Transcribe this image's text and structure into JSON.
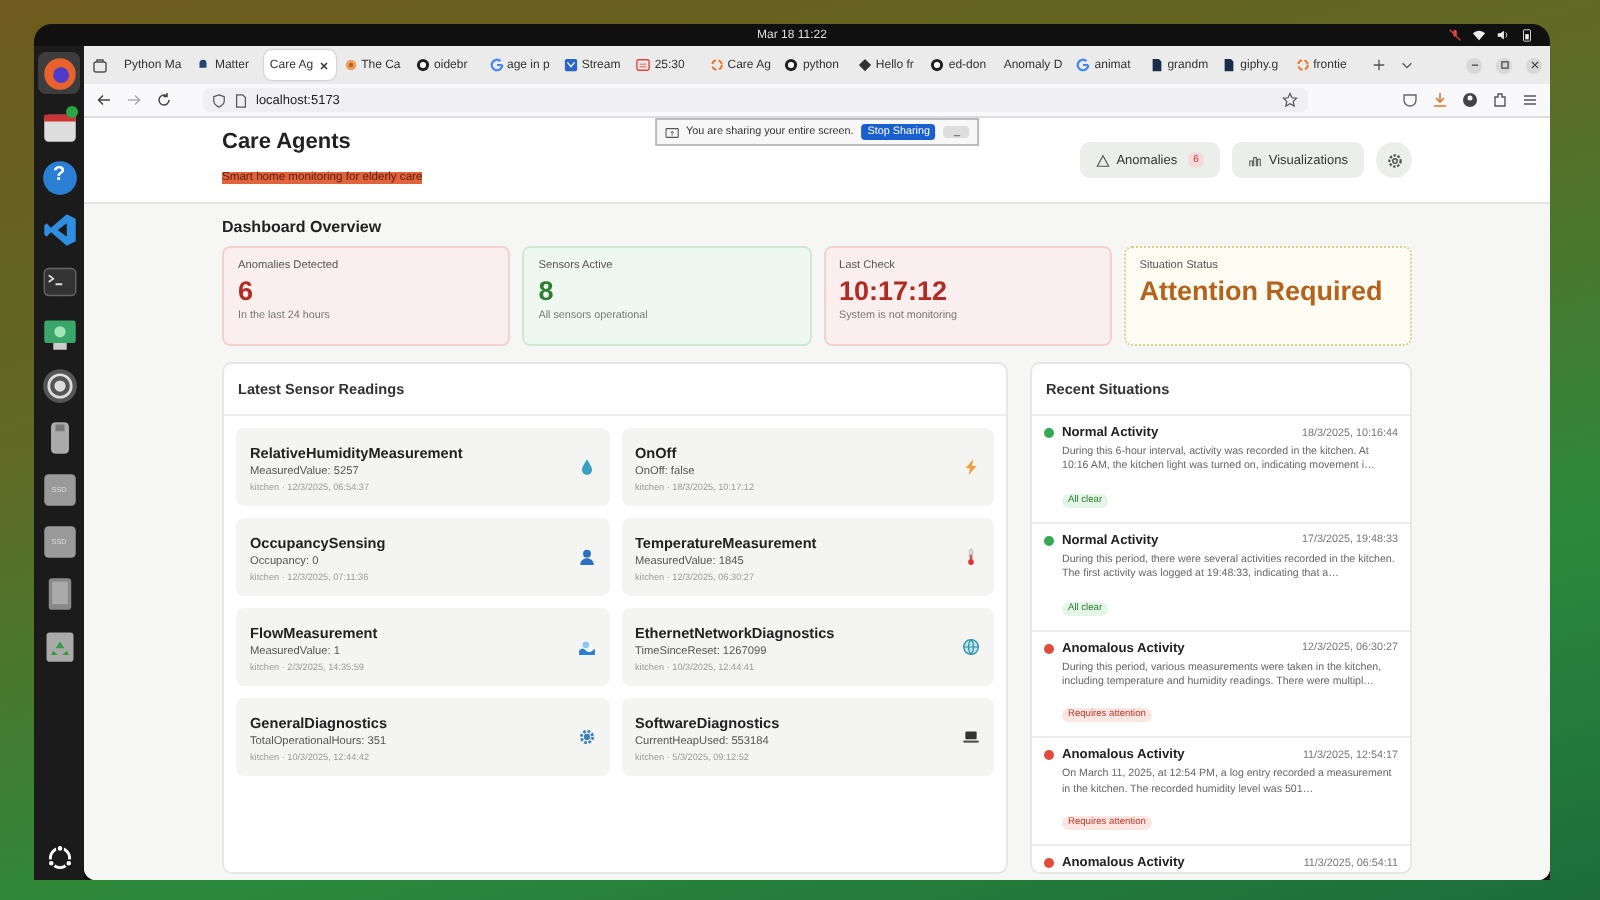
{
  "top_bar": {
    "clock": "Mar 18  11:22"
  },
  "dock": {
    "items": [
      {
        "kind": "browser",
        "active": true,
        "badge": false
      },
      {
        "kind": "calendar",
        "active": false,
        "badge": true
      },
      {
        "kind": "help",
        "active": false,
        "badge": false,
        "glyph": "?"
      },
      {
        "kind": "code",
        "active": false,
        "badge": false
      },
      {
        "kind": "terminal",
        "active": false,
        "badge": false
      },
      {
        "kind": "android",
        "active": false,
        "badge": false
      },
      {
        "kind": "settings",
        "active": false,
        "badge": false
      },
      {
        "kind": "usb",
        "active": false,
        "badge": false
      },
      {
        "kind": "drive",
        "active": false,
        "badge": false,
        "glyph": "SSD"
      },
      {
        "kind": "drive",
        "active": false,
        "badge": false,
        "glyph": "SSD"
      },
      {
        "kind": "tablet",
        "active": false,
        "badge": false
      },
      {
        "kind": "trash",
        "active": false,
        "badge": false
      }
    ]
  },
  "browser": {
    "tabs": [
      {
        "label": "Python Ma",
        "kind": "none",
        "selected": false
      },
      {
        "label": "Matter",
        "kind": "bell",
        "selected": false
      },
      {
        "label": "Care Ag",
        "kind": "none",
        "selected": true
      },
      {
        "label": "The Ca",
        "kind": "flower",
        "selected": false
      },
      {
        "label": "oidebr",
        "kind": "github",
        "selected": false
      },
      {
        "label": "age in p",
        "kind": "google",
        "selected": false
      },
      {
        "label": "Stream",
        "kind": "box",
        "selected": false
      },
      {
        "label": "25:30",
        "kind": "calendar",
        "selected": false
      },
      {
        "label": "Care Ag",
        "kind": "ring",
        "selected": false
      },
      {
        "label": "python",
        "kind": "github",
        "selected": false
      },
      {
        "label": "Hello fr",
        "kind": "diamond",
        "selected": false
      },
      {
        "label": "ed-don",
        "kind": "github",
        "selected": false
      },
      {
        "label": "Anomaly D",
        "kind": "none",
        "selected": false
      },
      {
        "label": "animat",
        "kind": "google",
        "selected": false
      },
      {
        "label": "grandm",
        "kind": "doc",
        "selected": false
      },
      {
        "label": "giphy.g",
        "kind": "doc",
        "selected": false
      },
      {
        "label": "frontie",
        "kind": "ring",
        "selected": false
      }
    ],
    "address": "localhost:5173"
  },
  "sharing_bar": {
    "message": "You are sharing your entire screen.",
    "stop_button": "Stop Sharing",
    "hide_button": "_"
  },
  "header": {
    "title": "Care Agents",
    "subtitle": "Smart home monitoring for elderly care",
    "subtitle_highlighted": true,
    "buttons": [
      {
        "label": "Anomalies",
        "badge": "6"
      },
      {
        "label": "Visualizations"
      }
    ]
  },
  "overview": {
    "title": "Dashboard Overview",
    "cards": [
      {
        "kind": "alert",
        "label": "Anomalies Detected",
        "value": "6",
        "note": "In the last 24 hours"
      },
      {
        "kind": "ok",
        "label": "Sensors Active",
        "value": "8",
        "note": "All sensors operational"
      },
      {
        "kind": "alert",
        "label": "Last Check",
        "value": "10:17:12",
        "note": "System is not monitoring"
      },
      {
        "kind": "warning",
        "label": "Situation Status",
        "value": "Attention Required"
      }
    ]
  },
  "sensors": {
    "title": "Latest Sensor Readings",
    "items": [
      {
        "kind": "humidity",
        "name": "RelativeHumidityMeasurement",
        "reading": "MeasuredValue: 5257",
        "meta": "kitchen · 12/3/2025, 06:54:37"
      },
      {
        "kind": "switch",
        "name": "OnOff",
        "reading": "OnOff: false",
        "meta": "kitchen · 18/3/2025, 10:17:12"
      },
      {
        "kind": "occupancy",
        "name": "OccupancySensing",
        "reading": "Occupancy: 0",
        "meta": "kitchen · 12/3/2025, 07:11:36"
      },
      {
        "kind": "temperature",
        "name": "TemperatureMeasurement",
        "reading": "MeasuredValue: 1845",
        "meta": "kitchen · 12/3/2025, 06:30:27"
      },
      {
        "kind": "flow",
        "name": "FlowMeasurement",
        "reading": "MeasuredValue: 1",
        "meta": "kitchen · 2/3/2025, 14:35:59"
      },
      {
        "kind": "network",
        "name": "EthernetNetworkDiagnostics",
        "reading": "TimeSinceReset: 1267099",
        "meta": "kitchen · 10/3/2025, 12:44:41"
      },
      {
        "kind": "diagnostics",
        "name": "GeneralDiagnostics",
        "reading": "TotalOperationalHours: 351",
        "meta": "kitchen · 10/3/2025, 12:44:42"
      },
      {
        "kind": "software",
        "name": "SoftwareDiagnostics",
        "reading": "CurrentHeapUsed: 553184",
        "meta": "kitchen · 5/3/2025, 09:12:52"
      }
    ]
  },
  "situations": {
    "title": "Recent Situations",
    "items": [
      {
        "kind": "normal",
        "title": "Normal Activity",
        "time": "18/3/2025, 10:16:44",
        "text": "During this 6-hour interval, activity was recorded in the kitchen. At 10:16 AM, the kitchen light was turned on, indicating movement i…",
        "badge": "All clear"
      },
      {
        "kind": "normal",
        "title": "Normal Activity",
        "time": "17/3/2025, 19:48:33",
        "text": "During this period, there were several activities recorded in the kitchen. The first activity was logged at 19:48:33, indicating that a…",
        "badge": "All clear"
      },
      {
        "kind": "anomaly",
        "title": "Anomalous Activity",
        "time": "12/3/2025, 06:30:27",
        "text": "During this period, various measurements were taken in the kitchen, including temperature and humidity readings. There were multipl…",
        "badge": "Requires attention"
      },
      {
        "kind": "anomaly",
        "title": "Anomalous Activity",
        "time": "11/3/2025, 12:54:17",
        "text": "On March 11, 2025, at 12:54 PM, a log entry recorded a measurement in the kitchen. The recorded humidity level was 501…",
        "badge": "Requires attention"
      },
      {
        "kind": "anomaly",
        "title": "Anomalous Activity",
        "time": "11/3/2025, 06:54:11"
      }
    ]
  }
}
